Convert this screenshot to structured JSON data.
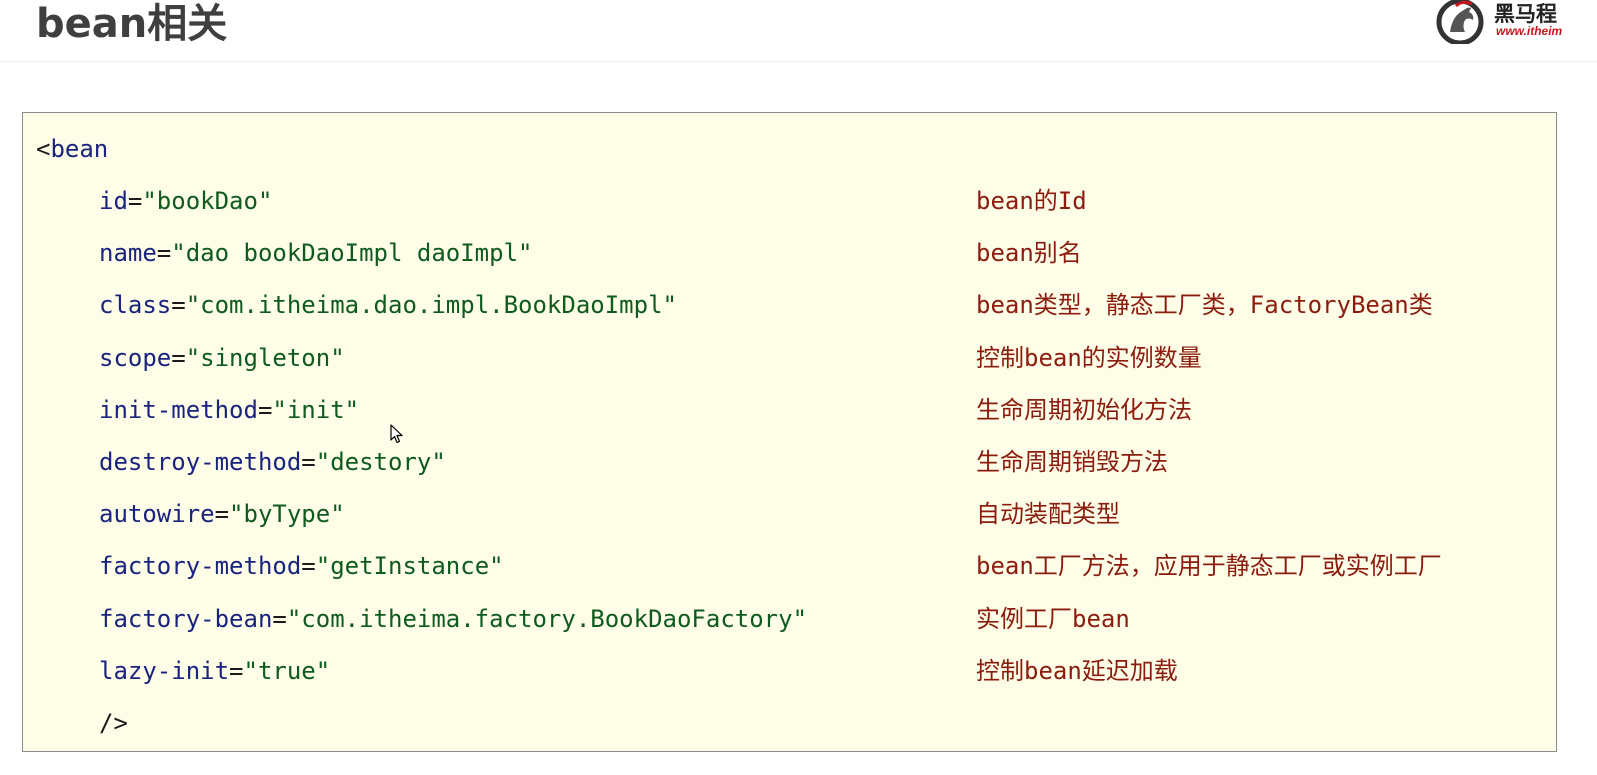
{
  "header": {
    "title": "bean相关",
    "logo": {
      "name": "黑马程",
      "url": "www.itheim"
    }
  },
  "code": {
    "open_bracket": "<",
    "tag": "bean",
    "close_tag": "/>",
    "attributes": [
      {
        "name": "id",
        "value": "\"bookDao\"",
        "comment": "bean的Id"
      },
      {
        "name": "name",
        "value": "\"dao bookDaoImpl daoImpl\"",
        "comment": "bean别名"
      },
      {
        "name": "class",
        "value": "\"com.itheima.dao.impl.BookDaoImpl\"",
        "comment": "bean类型，静态工厂类，FactoryBean类"
      },
      {
        "name": "scope",
        "value": "\"singleton\"",
        "comment": "控制bean的实例数量"
      },
      {
        "name": "init-method",
        "value": "\"init\"",
        "comment": "生命周期初始化方法"
      },
      {
        "name": "destroy-method",
        "value": "\"destory\"",
        "comment": "生命周期销毁方法"
      },
      {
        "name": "autowire",
        "value": "\"byType\"",
        "comment": "自动装配类型"
      },
      {
        "name": "factory-method",
        "value": "\"getInstance\"",
        "comment": "bean工厂方法，应用于静态工厂或实例工厂"
      },
      {
        "name": "factory-bean",
        "value": "\"com.itheima.factory.BookDaoFactory\"",
        "comment": "实例工厂bean"
      },
      {
        "name": "lazy-init",
        "value": "\"true\"",
        "comment": "控制bean延迟加载"
      }
    ]
  },
  "colors": {
    "code_background": "#fdfde8",
    "attribute": "#1a237e",
    "value": "#0f5a1e",
    "comment": "#8b1c0e",
    "logo_red": "#c8161d"
  },
  "icons": {
    "logo": "horse-logo-icon",
    "cursor": "mouse-pointer-icon"
  }
}
